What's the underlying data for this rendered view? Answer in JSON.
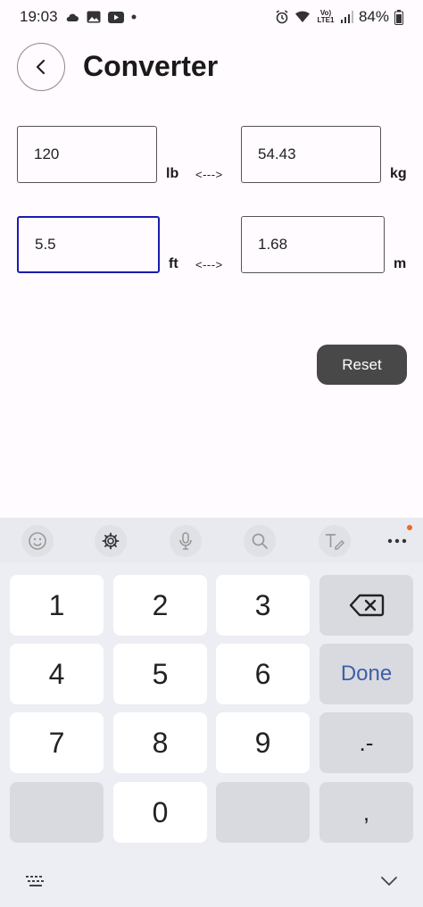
{
  "status_bar": {
    "time": "19:03",
    "network": "Vo) LTE1",
    "battery": "84%"
  },
  "header": {
    "title": "Converter"
  },
  "rows": [
    {
      "left_value": "120",
      "left_unit": "lb",
      "arrow": "<--->",
      "right_value": "54.43",
      "right_unit": "kg"
    },
    {
      "left_value": "5.5",
      "left_unit": "ft",
      "arrow": "<--->",
      "right_value": "1.68",
      "right_unit": "m"
    }
  ],
  "reset_label": "Reset",
  "keyboard": {
    "keys": [
      "1",
      "2",
      "3",
      "4",
      "5",
      "6",
      "7",
      "8",
      "9",
      "0",
      ".-",
      ","
    ],
    "done_label": "Done",
    "toolbar_icons": [
      "emoji-icon",
      "gear-icon",
      "mic-icon",
      "search-icon",
      "text-edit-icon",
      "more-icon"
    ]
  },
  "colors": {
    "focus_border": "#1b1bb0",
    "reset_bg": "#484848",
    "done_text": "#3f5fa6",
    "badge": "#f26a1b"
  }
}
